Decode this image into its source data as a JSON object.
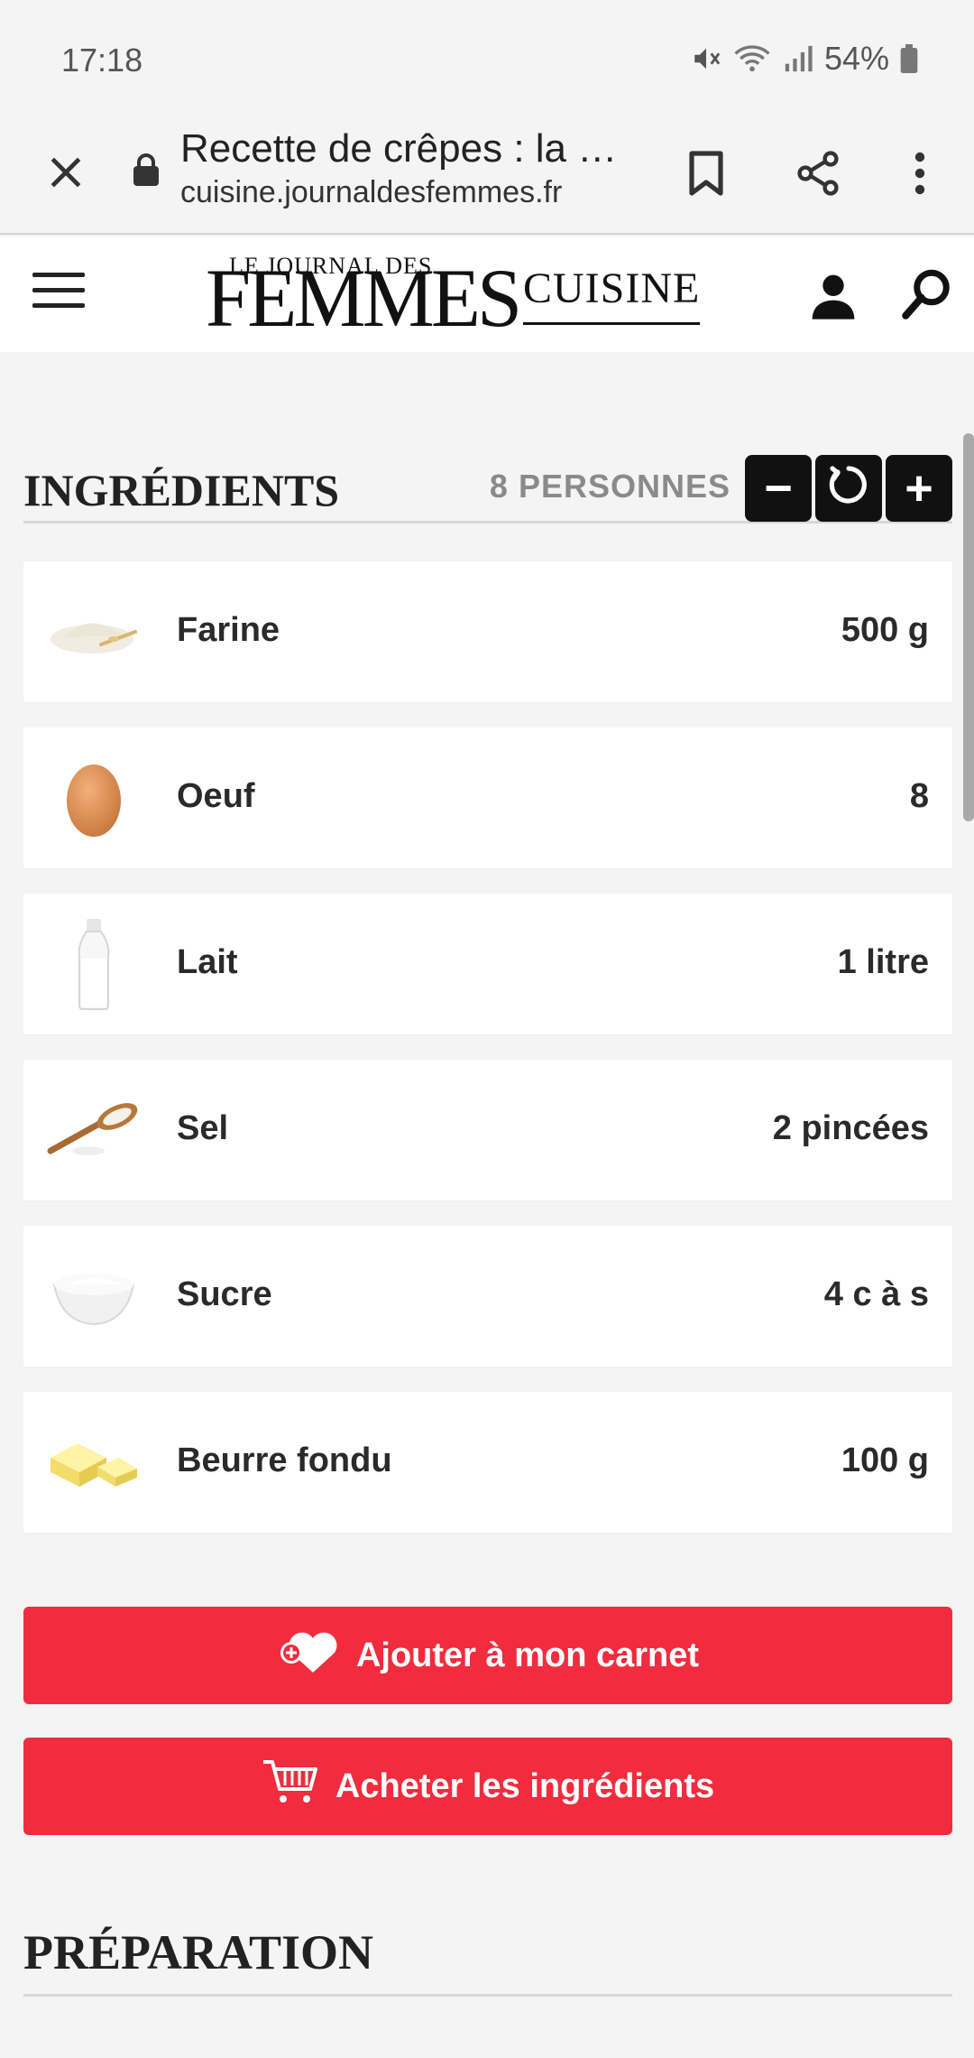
{
  "status_bar": {
    "time": "17:18",
    "battery": "54%"
  },
  "browser": {
    "title": "Recette de crêpes : la …",
    "url": "cuisine.journaldesfemmes.fr"
  },
  "site": {
    "logo_small": "LE JOURNAL DES",
    "logo_big": "FEMMES",
    "section": "CUISINE"
  },
  "ingredients": {
    "title": "INGRÉDIENTS",
    "persons": "8 PERSONNES",
    "controls": {
      "minus": "−",
      "plus": "+"
    },
    "items": [
      {
        "name": "Farine",
        "qty": "500 g",
        "icon": "flour-icon"
      },
      {
        "name": "Oeuf",
        "qty": "8",
        "icon": "egg-icon"
      },
      {
        "name": "Lait",
        "qty": "1 litre",
        "icon": "milk-bottle-icon"
      },
      {
        "name": "Sel",
        "qty": "2 pincées",
        "icon": "salt-spoon-icon"
      },
      {
        "name": "Sucre",
        "qty": "4 c à s",
        "icon": "sugar-bowl-icon"
      },
      {
        "name": "Beurre fondu",
        "qty": "100 g",
        "icon": "butter-icon"
      }
    ]
  },
  "actions": {
    "add_to_notebook": "Ajouter à mon carnet",
    "buy_ingredients": "Acheter les ingrédients"
  },
  "preparation": {
    "title": "PRÉPARATION"
  },
  "colors": {
    "accent": "#f02c3e",
    "dark": "#111111",
    "background": "#f4f4f4"
  }
}
